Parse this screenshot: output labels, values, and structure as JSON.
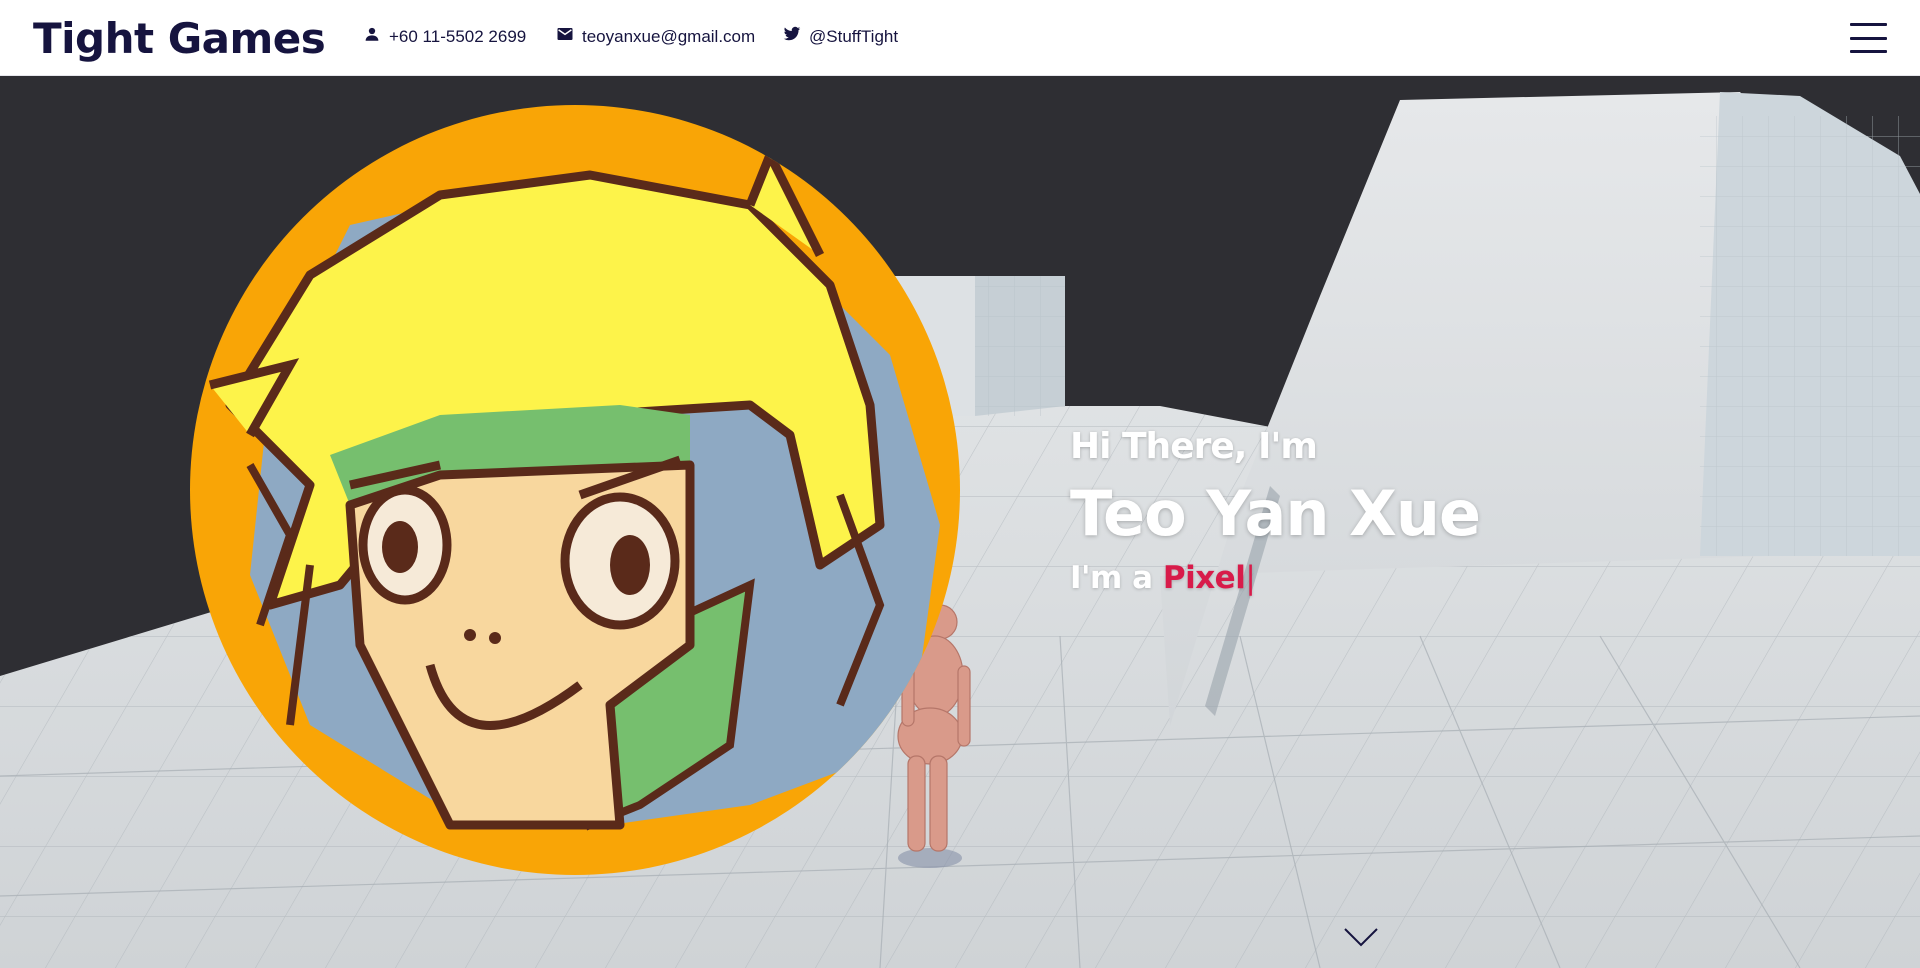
{
  "header": {
    "logo": "Tight Games",
    "phone": {
      "icon": "person-icon",
      "text": "+60 11-5502 2699"
    },
    "email": {
      "icon": "mail-icon",
      "text": "teoyanxue@gmail.com"
    },
    "twitter": {
      "icon": "twitter-icon",
      "text": "@StuffTight"
    },
    "menu_icon": "hamburger-menu-icon"
  },
  "hero": {
    "greeting": "Hi There, I'm",
    "name": "Teo Yan Xue",
    "role_prefix": "I'm a ",
    "role_word": "Pixel",
    "role_cursor": "|",
    "scroll_icon": "chevron-down-icon"
  },
  "colors": {
    "header_bg": "#ffffff",
    "brand_text": "#16143f",
    "accent": "#d81b4a",
    "scene_dark": "#2e2e33",
    "floor": "#d3d6d9",
    "portrait_bg": "#f9a506"
  }
}
